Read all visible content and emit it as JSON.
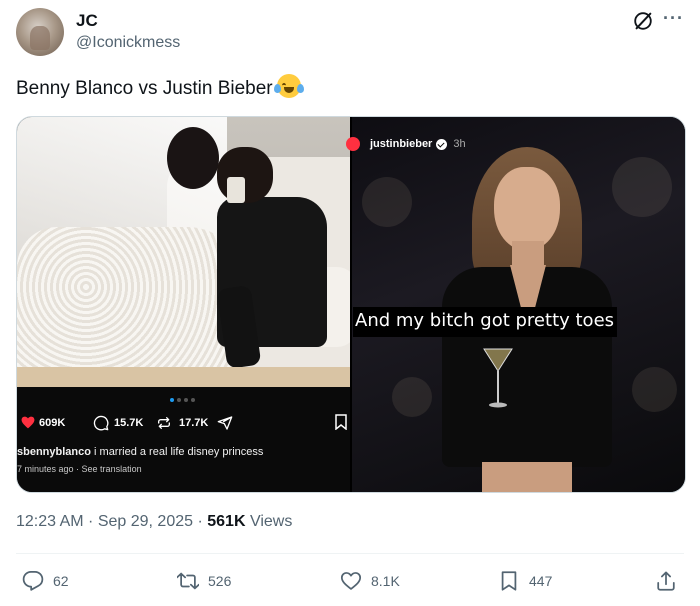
{
  "author": {
    "display_name": "JC",
    "handle": "@Iconickmess"
  },
  "tweet": {
    "text": "Benny Blanco vs Justin Bieber",
    "emoji": "face-with-tears-of-joy"
  },
  "media": {
    "left": {
      "likes": "609K",
      "comments": "15.7K",
      "reposts": "17.7K",
      "caption_user": "sbennyblanco",
      "caption_text": " i married a real life disney princess",
      "time_ago": "7 minutes ago",
      "see_translation": "See translation",
      "carousel_dots": 4,
      "active_dot": 0
    },
    "right": {
      "username": "justinbieber",
      "age": "3h",
      "caption": "And my bitch got pretty toes"
    }
  },
  "meta": {
    "time": "12:23 AM",
    "date": "Sep 29, 2025",
    "views_count": "561K",
    "views_label": " Views"
  },
  "actions": {
    "replies": "62",
    "reposts": "526",
    "likes": "8.1K",
    "bookmarks": "447"
  },
  "colors": {
    "text_primary": "#0f1419",
    "text_secondary": "#536471",
    "accent": "#1d9bf0",
    "ig_like": "#ff3040"
  }
}
